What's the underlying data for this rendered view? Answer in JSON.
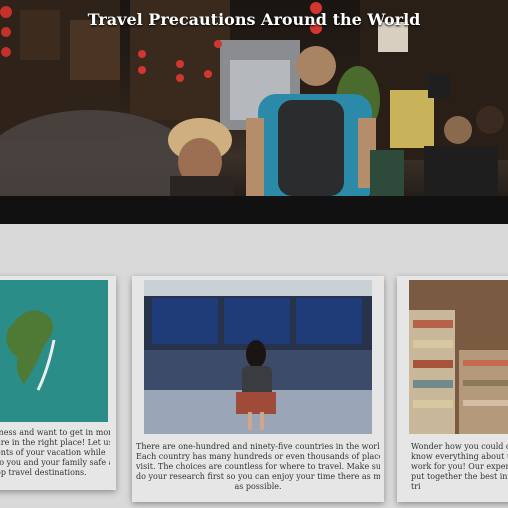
{
  "hero": {
    "title": "Travel Precautions Around the World"
  },
  "cards": [
    {
      "lines": [
        "iness and want to get in more",
        "are in the right place! Let us",
        "ents of your vacation while",
        "to you and your family safe as",
        "op travel destinations."
      ]
    },
    {
      "lines": [
        "There are one-hundred and ninety-five countries in the world.",
        "Each country has many hundreds or even thousands of places to",
        "visit. The choices are countless for where to travel. Make sure to",
        "do your research first so you can enjoy your time there as much",
        "as possible."
      ]
    },
    {
      "lines": [
        "Wonder how you could co",
        "know everything about u",
        "work for you! Our experts",
        "put together the best info",
        "tri"
      ]
    }
  ],
  "colors": {
    "background": "#d9d9d9",
    "card": "#e6e6e6",
    "title": "#ffffff"
  }
}
